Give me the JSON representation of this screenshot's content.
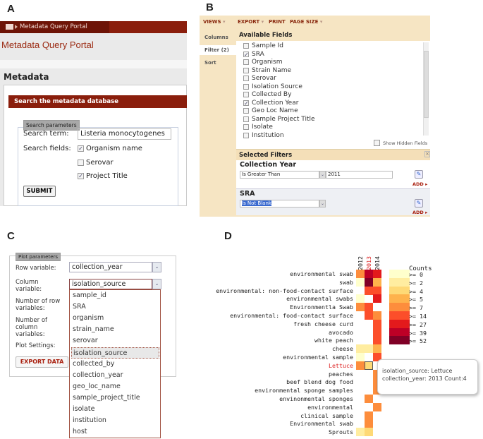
{
  "panel_labels": [
    "A",
    "B",
    "C",
    "D"
  ],
  "panel_a": {
    "tab_label": "Metadata Query Portal",
    "page_title": "Metadata Query Portal",
    "section_title": "Metadata",
    "box_title": "Search the metadata database",
    "fieldset_legend": "Search parameters",
    "search_term_label": "Search term:",
    "search_term_value": "Listeria monocytogenes",
    "search_fields_label": "Search fields:",
    "fields": [
      {
        "label": "Organism name",
        "checked": true
      },
      {
        "label": "Serovar",
        "checked": false
      },
      {
        "label": "Project Title",
        "checked": true
      }
    ],
    "submit_label": "SUBMIT"
  },
  "panel_b": {
    "toolbar": [
      "VIEWS",
      "EXPORT",
      "PRINT",
      "PAGE SIZE"
    ],
    "side_tabs": [
      "Columns",
      "Filter (2)",
      "Sort"
    ],
    "available_fields_title": "Available Fields",
    "fields": [
      {
        "label": "Sample Id",
        "checked": false
      },
      {
        "label": "SRA",
        "checked": true
      },
      {
        "label": "Organism",
        "checked": false
      },
      {
        "label": "Strain Name",
        "checked": false
      },
      {
        "label": "Serovar",
        "checked": false
      },
      {
        "label": "Isolation Source",
        "checked": false
      },
      {
        "label": "Collected By",
        "checked": false
      },
      {
        "label": "Collection Year",
        "checked": true
      },
      {
        "label": "Geo Loc Name",
        "checked": false
      },
      {
        "label": "Sample Project Title",
        "checked": false
      },
      {
        "label": "Isolate",
        "checked": false
      },
      {
        "label": "Institution",
        "checked": false
      }
    ],
    "show_hidden_label": "Show Hidden Fields",
    "selected_filters_title": "Selected Filters",
    "filters": [
      {
        "field": "Collection Year",
        "operator": "Is Greater Than",
        "value": "2011",
        "add": "ADD"
      },
      {
        "field": "SRA",
        "operator": "Is Not Blank",
        "value": "",
        "add": "ADD"
      }
    ]
  },
  "panel_c": {
    "legend": "Plot parameters",
    "row_variable_label": "Row variable:",
    "row_variable_value": "collection_year",
    "column_variable_label": "Column variable:",
    "column_variable_value": "isolation_source",
    "num_row_label": "Number of row variables:",
    "num_col_label": "Number of column variables:",
    "plot_settings_label": "Plot Settings:",
    "export_label": "EXPORT DATA",
    "options": [
      "sample_id",
      "SRA",
      "organism",
      "strain_name",
      "serovar",
      "isolation_source",
      "collected_by",
      "collection_year",
      "geo_loc_name",
      "sample_project_title",
      "isolate",
      "institution",
      "host"
    ],
    "highlighted_option": "isolation_source"
  },
  "chart_data": {
    "type": "heatmap",
    "columns": [
      "2012",
      "2013",
      "2014"
    ],
    "highlighted_column": "2013",
    "rows": [
      "environmental swab",
      "swab",
      "environmental: non-food-contact surface",
      "environmental swabs",
      "Environmentla Swab",
      "environmental: food-contact surface",
      "fresh cheese curd",
      "avocado",
      "white peach",
      "cheese",
      "environmental sample",
      "Lettuce",
      "peaches",
      "beef blend dog food",
      "environmental sponge samples",
      "envinonmental sponges",
      "environmental",
      "clinical sample",
      "Environmental swab",
      "Sprouts"
    ],
    "highlighted_row": "Lettuce",
    "values_bin_min": [
      [
        7,
        39,
        27
      ],
      [
        0,
        52,
        5
      ],
      [
        null,
        14,
        14
      ],
      [
        0,
        null,
        27
      ],
      [
        7,
        14,
        null
      ],
      [
        null,
        14,
        7
      ],
      [
        null,
        null,
        14
      ],
      [
        null,
        null,
        14
      ],
      [
        null,
        null,
        14
      ],
      [
        2,
        2,
        5
      ],
      [
        0,
        null,
        14
      ],
      [
        7,
        4,
        null
      ],
      [
        null,
        null,
        7
      ],
      [
        null,
        null,
        7
      ],
      [
        null,
        null,
        7
      ],
      [
        null,
        7,
        null
      ],
      [
        null,
        null,
        7
      ],
      [
        null,
        7,
        null
      ],
      [
        null,
        7,
        null
      ],
      [
        2,
        4,
        null
      ]
    ],
    "legend_title": "Counts",
    "legend_bins": [
      ">= 0",
      ">= 2",
      ">= 4",
      ">= 5",
      ">= 7",
      ">= 14",
      ">= 27",
      ">= 39",
      ">= 52"
    ],
    "legend_thresholds": [
      0,
      2,
      4,
      5,
      7,
      14,
      27,
      39,
      52
    ],
    "legend_colors": [
      "#ffffcc",
      "#ffeda0",
      "#fed976",
      "#feb24c",
      "#fd8d3c",
      "#fc4e2a",
      "#e31a1c",
      "#bd0026",
      "#800026"
    ],
    "tooltip": {
      "line1": "isolation_source: Lettuce",
      "line2": "collection_year: 2013 Count:4"
    }
  }
}
